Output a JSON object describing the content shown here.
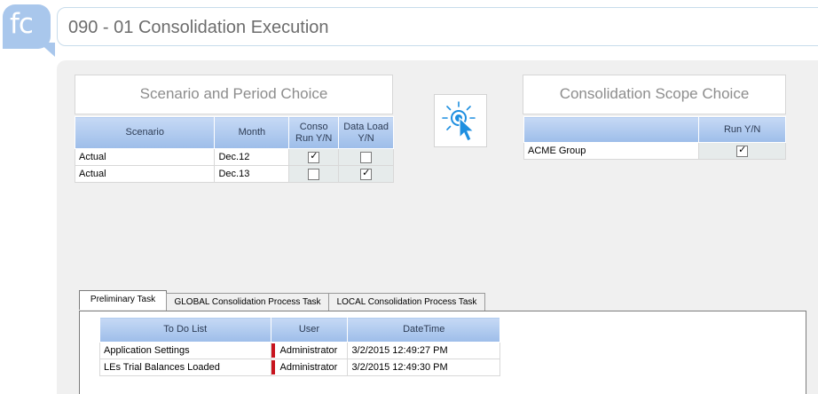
{
  "logo": {
    "text": "fc"
  },
  "header": {
    "title": "090 - 01 Consolidation Execution"
  },
  "scenario_panel": {
    "title": "Scenario and Period Choice",
    "columns": [
      "Scenario",
      "Month",
      "Conso Run Y/N",
      "Data Load Y/N"
    ],
    "rows": [
      {
        "scenario": "Actual",
        "month": "Dec.12",
        "conso_run": true,
        "data_load": false
      },
      {
        "scenario": "Actual",
        "month": "Dec.13",
        "conso_run": false,
        "data_load": true
      }
    ]
  },
  "scope_panel": {
    "title": "Consolidation Scope Choice",
    "columns": [
      "",
      "Run Y/N"
    ],
    "rows": [
      {
        "entity": "ACME Group",
        "run": true
      }
    ]
  },
  "execute_button": {
    "icon": "click-pointer-icon",
    "color": "#1e8fe0"
  },
  "tabs": [
    {
      "label": "Preliminary Task",
      "active": true
    },
    {
      "label": "GLOBAL Consolidation Process Task",
      "active": false
    },
    {
      "label": "LOCAL Consolidation Process Task",
      "active": false
    }
  ],
  "task_table": {
    "columns": [
      "To Do List",
      "User",
      "DateTime"
    ],
    "rows": [
      {
        "todo": "Application Settings",
        "user": "Administrator",
        "datetime": "3/2/2015 12:49:27 PM"
      },
      {
        "todo": "LEs Trial Balances Loaded",
        "user": "Administrator",
        "datetime": "3/2/2015 12:49:30 PM"
      }
    ]
  },
  "colors": {
    "header_blue": "#9dbde9",
    "status_red": "#c8141e",
    "logo_blue": "#a9c7ec"
  }
}
